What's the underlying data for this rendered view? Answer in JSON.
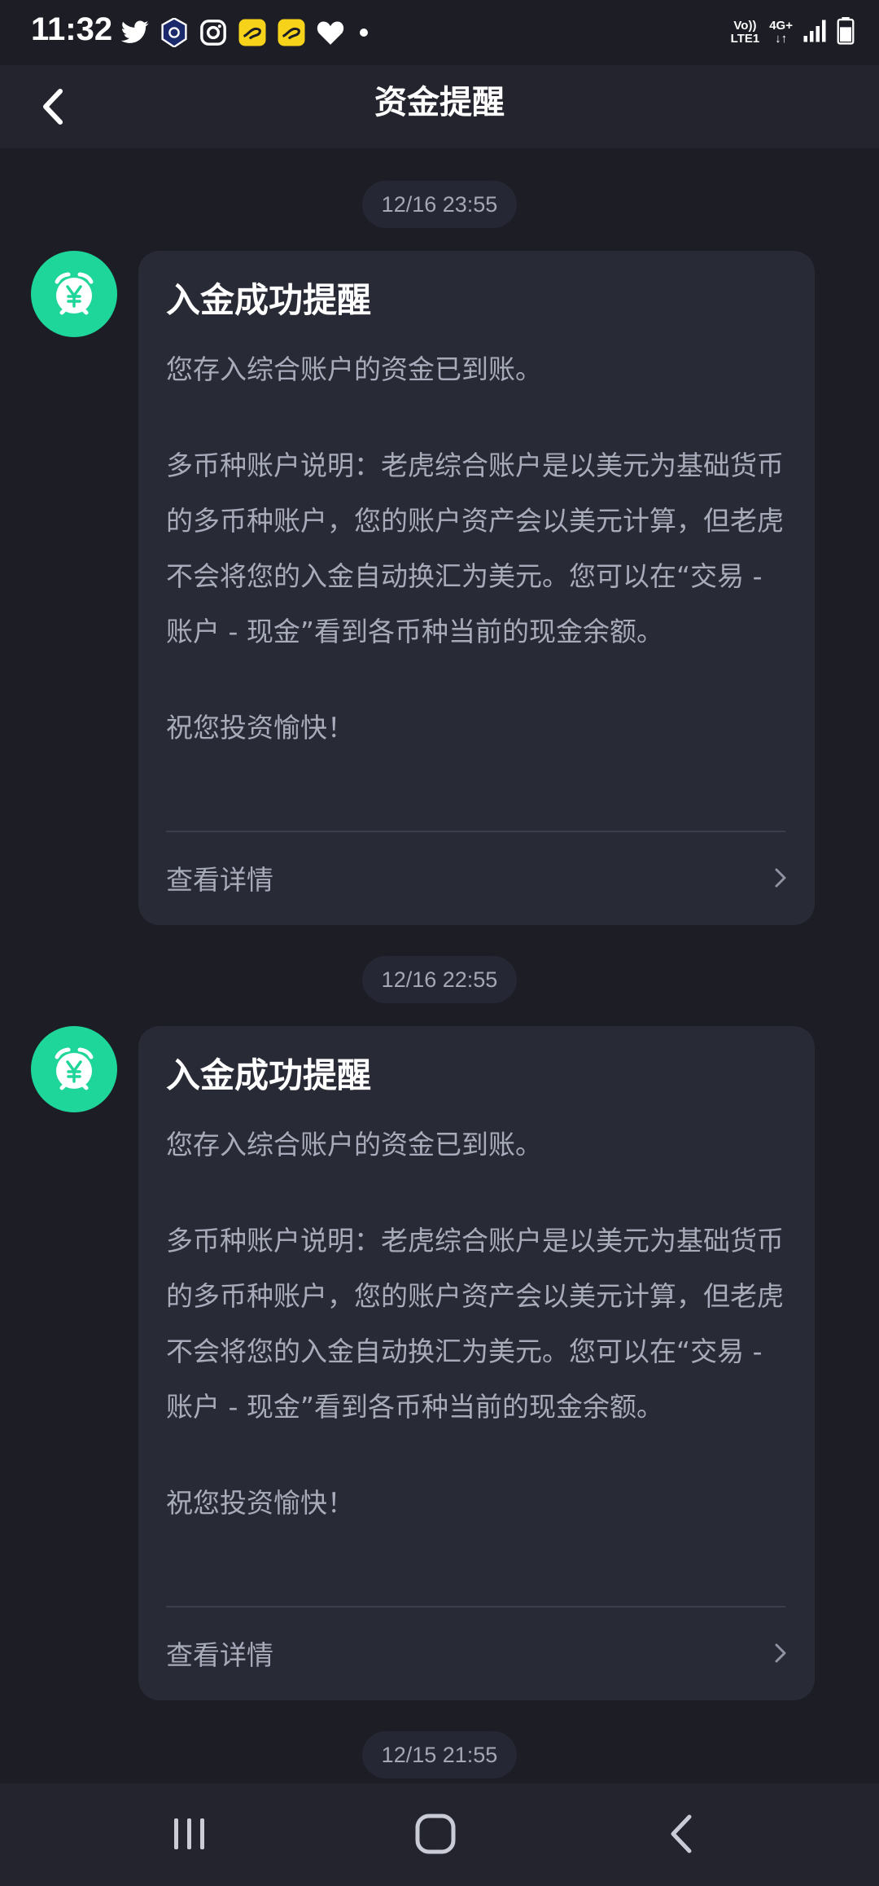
{
  "status_bar": {
    "time": "11:32",
    "app_icons": [
      "twitter-icon",
      "crypto-shield-icon",
      "instagram-icon",
      "yellow-app-icon",
      "yellow-app-icon",
      "heart-icon"
    ],
    "network_top": "Vo))",
    "network_bottom": "LTE1",
    "data_top": "4G+",
    "data_bottom": "↓↑"
  },
  "header": {
    "title": "资金提醒",
    "back_icon": "chevron-left-icon"
  },
  "messages": [
    {
      "time": "12/16 23:55",
      "title": "入金成功提醒",
      "line1": "您存入综合账户的资金已到账。",
      "para1": "多币种账户说明：老虎综合账户是以美元为基础货币的多币种账户，您的账户资产会以美元计算，但老虎不会将您的入金自动换汇为美元。您可以在“交易 - 账户 - 现金”看到各币种当前的现金余额。",
      "closing": "祝您投资愉快！",
      "detail_label": "查看详情"
    },
    {
      "time": "12/16 22:55",
      "title": "入金成功提醒",
      "line1": "您存入综合账户的资金已到账。",
      "para1": "多币种账户说明：老虎综合账户是以美元为基础货币的多币种账户，您的账户资产会以美元计算，但老虎不会将您的入金自动换汇为美元。您可以在“交易 - 账户 - 现金”看到各币种当前的现金余额。",
      "closing": "祝您投资愉快！",
      "detail_label": "查看详情"
    },
    {
      "time": "12/15 21:55"
    }
  ],
  "colors": {
    "background": "#1c1d25",
    "card": "#282a36",
    "accent_green": "#1ed699",
    "text_secondary": "#a8abba"
  }
}
